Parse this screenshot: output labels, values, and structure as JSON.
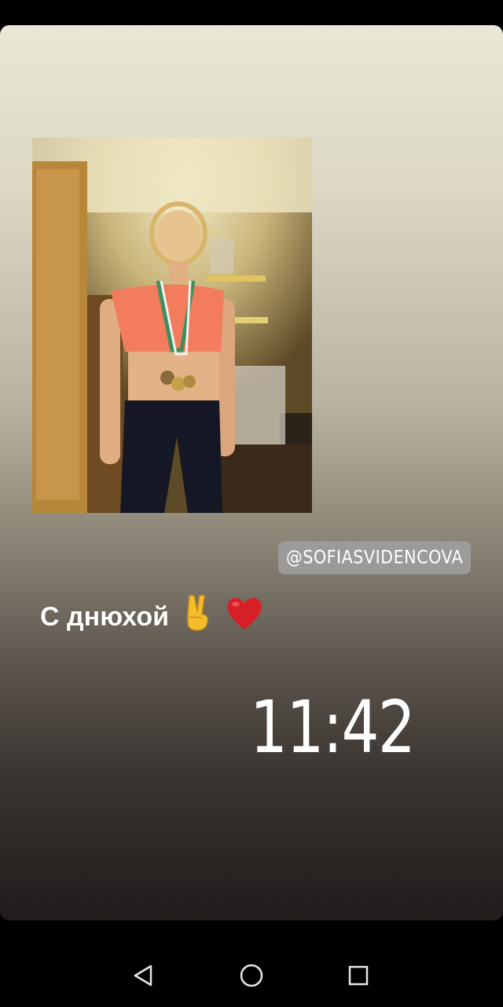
{
  "story": {
    "mention": "@SOFIASVIDENCOVA",
    "caption_text": "С днюхой",
    "caption_emojis": [
      "victory-hand-emoji",
      "red-heart-emoji"
    ],
    "time_sticker": "11:42"
  },
  "navbar": {
    "back_icon": "back-triangle-icon",
    "home_icon": "home-circle-icon",
    "recents_icon": "recents-square-icon"
  },
  "colors": {
    "background_top": "#e9e7d6",
    "background_bottom": "#201c1b",
    "mention_bg": "#a0a0a0",
    "heart": "#d61f26"
  }
}
